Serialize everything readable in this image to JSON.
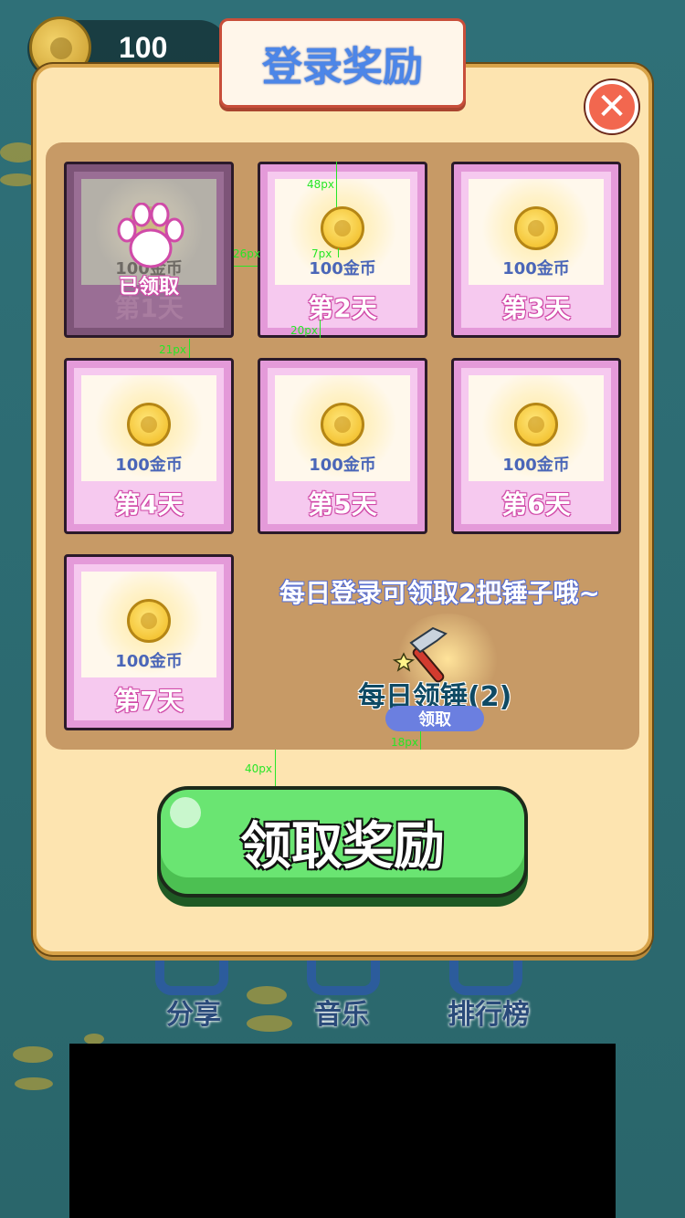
{
  "header": {
    "coin_count": "100"
  },
  "background_menu": {
    "share": "分享",
    "music": "音乐",
    "leaderboard": "排行榜"
  },
  "modal": {
    "title": "登录奖励",
    "close_icon": "close-icon",
    "days": [
      {
        "amount": "100金币",
        "label": "第1天",
        "claimed": true,
        "claimed_text": "已领取"
      },
      {
        "amount": "100金币",
        "label": "第2天",
        "claimed": false
      },
      {
        "amount": "100金币",
        "label": "第3天",
        "claimed": false
      },
      {
        "amount": "100金币",
        "label": "第4天",
        "claimed": false
      },
      {
        "amount": "100金币",
        "label": "第5天",
        "claimed": false
      },
      {
        "amount": "100金币",
        "label": "第6天",
        "claimed": false
      },
      {
        "amount": "100金币",
        "label": "第7天",
        "claimed": false
      }
    ],
    "hint": "每日登录可领取2把锤子哦~",
    "hammer": {
      "label": "每日领锤(2)",
      "button": "领取"
    },
    "claim_button": "领取奖励"
  },
  "annotations": [
    "48px",
    "7px",
    "20px",
    "26px",
    "21px",
    "40px",
    "18px"
  ],
  "colors": {
    "accent_green": "#6ae572",
    "card_pink": "#f6c9ef",
    "title_blue": "#4c86e8",
    "close_red": "#f2674f"
  }
}
